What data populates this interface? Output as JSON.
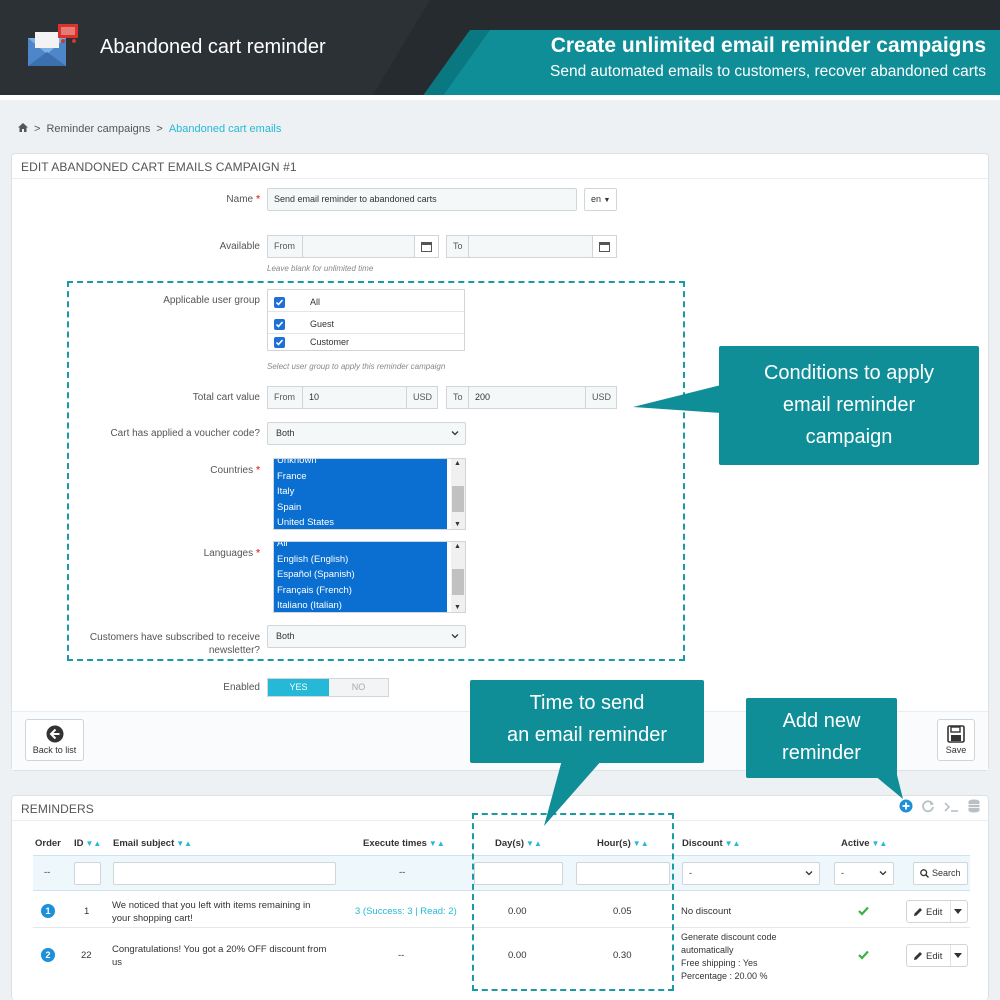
{
  "banner": {
    "app_title": "Abandoned cart reminder",
    "headline": "Create unlimited email reminder campaigns",
    "subline": "Send automated emails to customers, recover abandoned carts"
  },
  "breadcrumb": {
    "home_icon": "home-icon",
    "items": [
      "Reminder campaigns",
      "Abandoned cart emails"
    ]
  },
  "form": {
    "title": "EDIT ABANDONED CART EMAILS CAMPAIGN #1",
    "name_label": "Name",
    "name_value": "Send email reminder to abandoned carts",
    "lang": "en",
    "available_label": "Available",
    "from_label": "From",
    "to_label": "To",
    "available_help": "Leave blank for unlimited time",
    "user_group_label": "Applicable user group",
    "user_groups": [
      "All",
      "Guest",
      "Customer"
    ],
    "user_group_help": "Select user group to apply this reminder campaign",
    "cart_value_label": "Total cart value",
    "cart_from": "10",
    "cart_to": "200",
    "currency": "USD",
    "voucher_label": "Cart has applied a voucher code?",
    "voucher_value": "Both",
    "countries_label": "Countries",
    "countries": [
      "Unknown",
      "France",
      "Italy",
      "Spain",
      "United States"
    ],
    "languages_label": "Languages",
    "languages": [
      "All",
      "English (English)",
      "Español (Spanish)",
      "Français (French)",
      "Italiano (Italian)"
    ],
    "newsletter_label_1": "Customers have subscribed to receive",
    "newsletter_label_2": "newsletter?",
    "newsletter_value": "Both",
    "enabled_label": "Enabled",
    "yes": "YES",
    "no": "NO",
    "back_label": "Back to list",
    "save_label": "Save"
  },
  "callouts": {
    "conditions": [
      "Conditions to apply",
      "email reminder",
      "campaign"
    ],
    "time": [
      "Time to send",
      "an email reminder"
    ],
    "add": [
      "Add new",
      "reminder"
    ]
  },
  "reminders": {
    "title": "REMINDERS",
    "columns": [
      "Order",
      "ID",
      "Email subject",
      "Execute times",
      "Day(s)",
      "Hour(s)",
      "Discount",
      "Active"
    ],
    "filter_order": "--",
    "filter_execute": "--",
    "filter_discount": "-",
    "filter_active": "-",
    "search_label": "Search",
    "edit_label": "Edit",
    "rows": [
      {
        "order": "1",
        "id": "1",
        "subject_1": "We noticed that you left with items remaining in",
        "subject_2": "your shopping cart!",
        "execute": "3 (Success: 3 | Read: 2)",
        "days": "0.00",
        "hours": "0.05",
        "discount_1": "No discount",
        "discount_2": "",
        "discount_3": "",
        "discount_4": ""
      },
      {
        "order": "2",
        "id": "22",
        "subject_1": "Congratulations! You got a 20% OFF discount from",
        "subject_2": "us",
        "execute": "--",
        "days": "0.00",
        "hours": "0.30",
        "discount_1": "Generate discount code",
        "discount_2": "automatically",
        "discount_3": "Free shipping : Yes",
        "discount_4": "Percentage : 20.00 %"
      }
    ]
  },
  "colors": {
    "brand_teal": "#0f8e98",
    "accent_blue": "#25b9d7",
    "banner_dark": "#262b2f"
  }
}
